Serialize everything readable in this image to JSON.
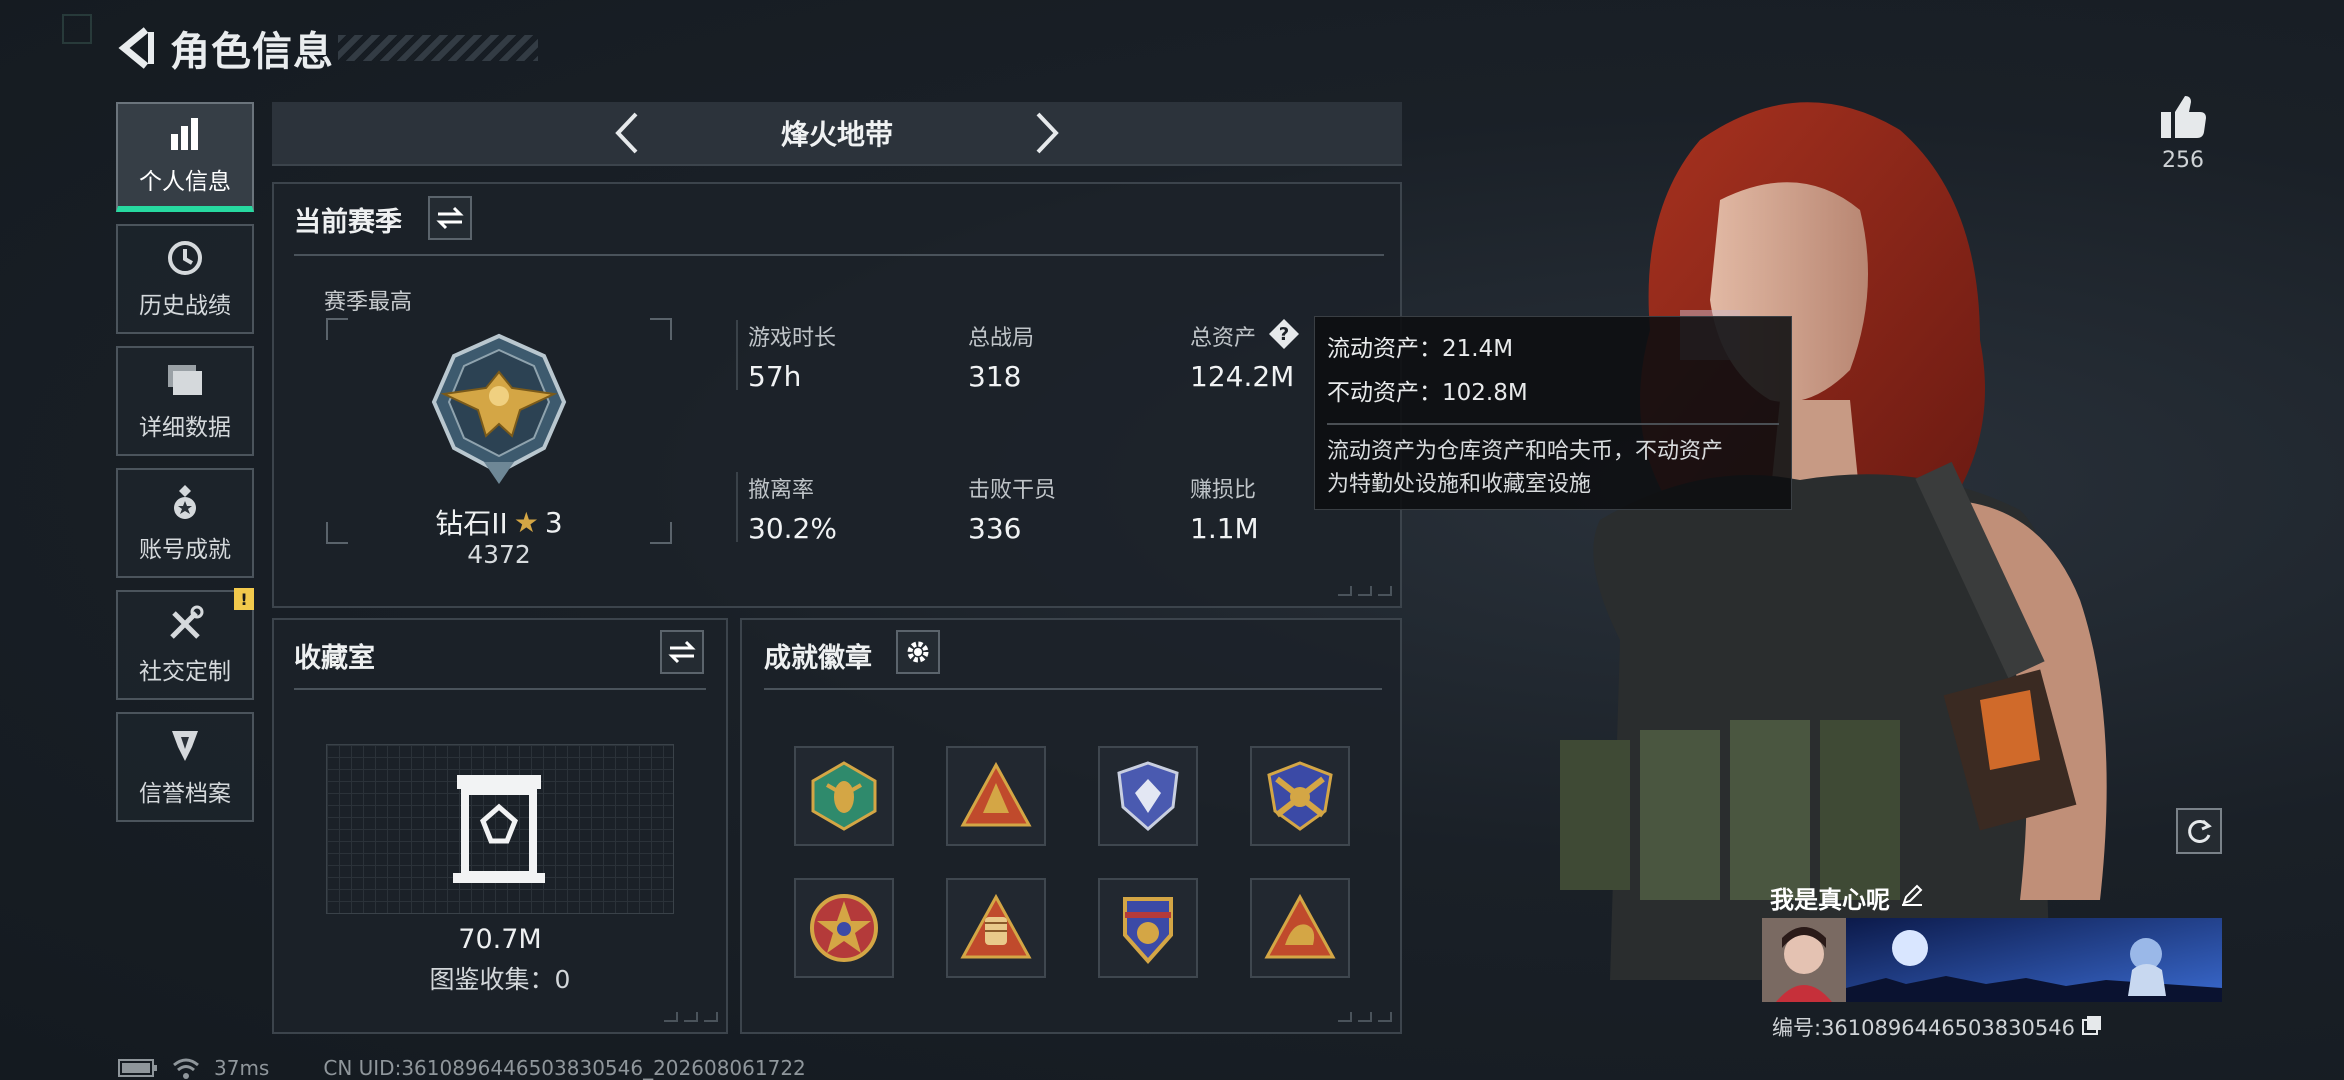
{
  "header": {
    "title": "角色信息"
  },
  "nav": {
    "items": [
      {
        "label": "个人信息",
        "icon": "bar-chart-icon",
        "active": true
      },
      {
        "label": "历史战绩",
        "icon": "history-clock-icon"
      },
      {
        "label": "详细数据",
        "icon": "folder-icon"
      },
      {
        "label": "账号成就",
        "icon": "medal-icon"
      },
      {
        "label": "社交定制",
        "icon": "tools-icon",
        "badge": "!"
      },
      {
        "label": "信誉档案",
        "icon": "shield-emblem-icon"
      }
    ]
  },
  "mode": {
    "name": "烽火地带"
  },
  "season": {
    "title": "当前赛季",
    "best_label": "赛季最高",
    "rank_name": "钻石II",
    "rank_stars": "3",
    "rank_score": "4372",
    "stats": [
      {
        "label": "游戏时长",
        "value": "57h"
      },
      {
        "label": "总战局",
        "value": "318"
      },
      {
        "label": "总资产",
        "value": "124.2M"
      },
      {
        "label": "撤离率",
        "value": "30.2%"
      },
      {
        "label": "击败干员",
        "value": "336"
      },
      {
        "label": "赚损比",
        "value": "1.1M"
      }
    ]
  },
  "tooltip": {
    "liquid": "流动资产：21.4M",
    "fixed": "不动资产：102.8M",
    "desc_line1": "流动资产为仓库资产和哈夫币，不动资产",
    "desc_line2": "为特勤处设施和收藏室设施"
  },
  "collection": {
    "title": "收藏室",
    "value": "70.7M",
    "count": "图鉴收集：0"
  },
  "achievements": {
    "title": "成就徽章",
    "badges": [
      {
        "icon": "hornet-badge-icon",
        "color": "#2f8a6c"
      },
      {
        "icon": "triangle-badge-icon",
        "color": "#c04a2c"
      },
      {
        "icon": "shield-crystal-badge-icon",
        "color": "#4a5ab0"
      },
      {
        "icon": "crossed-rifles-badge-icon",
        "color": "#3b4aa6"
      },
      {
        "icon": "star-medal-badge-icon",
        "color": "#b43a3a"
      },
      {
        "icon": "fist-badge-icon",
        "color": "#c04a2c"
      },
      {
        "icon": "shield-eagle-badge-icon",
        "color": "#3b4aa6"
      },
      {
        "icon": "hand-triangle-badge-icon",
        "color": "#c04a2c"
      }
    ]
  },
  "profile": {
    "likes": "256",
    "name": "我是真心呢",
    "id": "编号:3610896446503830546"
  },
  "status": {
    "ping": "37ms",
    "uid": "CN UID:3610896446503830546_202608061722"
  },
  "colors": {
    "accent": "#27d9a0",
    "alert": "#f2c94c",
    "gold": "#d4a645"
  }
}
